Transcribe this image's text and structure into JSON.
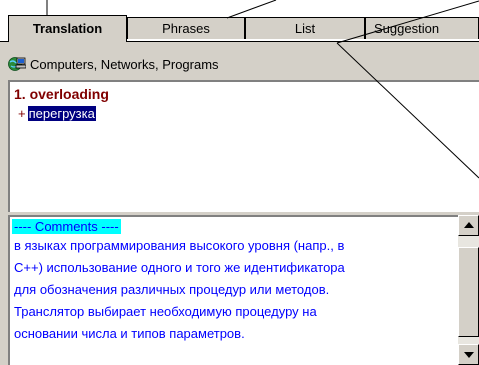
{
  "tabs": [
    {
      "label": "Translation",
      "active": true
    },
    {
      "label": "Phrases",
      "active": false
    },
    {
      "label": "List",
      "active": false
    },
    {
      "label": "Suggestion",
      "active": false
    }
  ],
  "category": {
    "label": "Computers, Networks, Programs",
    "icon": "globe-computer-icon"
  },
  "entry": {
    "headword": "1. overloading",
    "translation_prefix": "+",
    "translation": "перегрузка"
  },
  "comments": {
    "header": "---- Comments ----",
    "lines": [
      "в языках программирования высокого уровня (напр., в",
      "C++) использование одного и того же идентификатора",
      "для обозначения различных процедур или методов.",
      "Транслятор выбирает необходимую процедуру на",
      "основании числа и типов параметров."
    ]
  },
  "colors": {
    "panel": "#d4d0c8",
    "headword": "#800000",
    "selection": "#000080",
    "comment_text": "#0000ff",
    "comment_header_bg": "#00ffff"
  }
}
